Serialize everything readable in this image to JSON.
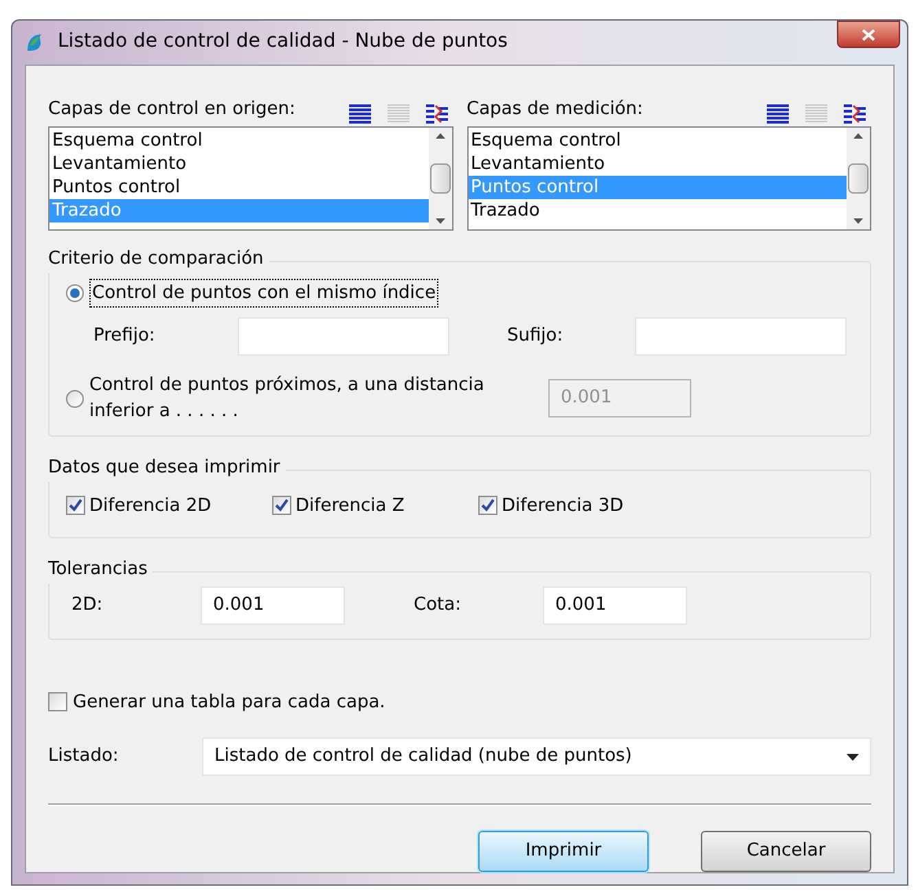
{
  "window": {
    "title": "Listado de control de calidad - Nube de puntos"
  },
  "layer_lists": [
    {
      "label": "Capas de control en origen:",
      "items": [
        {
          "text": "Esquema control",
          "selected": false
        },
        {
          "text": "Levantamiento",
          "selected": false
        },
        {
          "text": "Puntos control",
          "selected": false
        },
        {
          "text": "Trazado",
          "selected": true
        }
      ]
    },
    {
      "label": "Capas de medición:",
      "items": [
        {
          "text": "Esquema control",
          "selected": false
        },
        {
          "text": "Levantamiento",
          "selected": false
        },
        {
          "text": "Puntos control",
          "selected": true
        },
        {
          "text": "Trazado",
          "selected": false
        }
      ]
    }
  ],
  "comparison": {
    "title": "Criterio de comparación",
    "options": [
      {
        "label": "Control de puntos con el mismo índice",
        "selected": true
      },
      {
        "label": "Control de puntos próximos, a una distancia inferior a . . . . . .",
        "selected": false
      }
    ],
    "prefix_label": "Prefijo:",
    "suffix_label": "Sufijo:",
    "distance": {
      "value": "0.001",
      "disabled": true
    }
  },
  "print_data": {
    "title": "Datos que desea imprimir",
    "options": [
      {
        "label": "Diferencia 2D",
        "checked": true
      },
      {
        "label": "Diferencia Z",
        "checked": true
      },
      {
        "label": "Diferencia 3D",
        "checked": true
      }
    ]
  },
  "tolerances": {
    "title": "Tolerancias",
    "fields": [
      {
        "label": "2D:",
        "value": "0.001"
      },
      {
        "label": "Cota:",
        "value": "0.001"
      }
    ]
  },
  "table_per_layer": {
    "label": "Generar una tabla para cada capa.",
    "checked": false
  },
  "report": {
    "label": "Listado:",
    "value": "Listado de control de calidad (nube de puntos)"
  },
  "buttons": [
    {
      "label": "Imprimir",
      "kind": "default"
    },
    {
      "label": "Cancelar",
      "kind": "normal"
    }
  ]
}
